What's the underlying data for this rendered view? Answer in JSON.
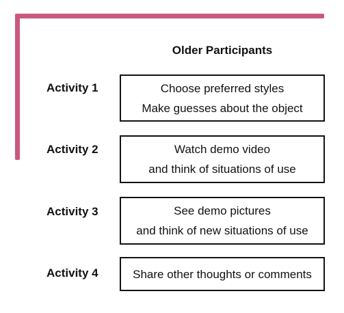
{
  "title": "Older Participants",
  "activities": [
    {
      "label": "Activity 1",
      "lines": [
        "Choose preferred styles",
        "Make guesses about the object"
      ]
    },
    {
      "label": "Activity 2",
      "lines": [
        "Watch demo video",
        "and think of situations of use"
      ]
    },
    {
      "label": "Activity 3",
      "lines": [
        "See demo pictures",
        "and think of new situations of use"
      ]
    },
    {
      "label": "Activity 4",
      "lines": [
        "Share other thoughts or comments"
      ]
    }
  ],
  "colors": {
    "frame": "#c9587f",
    "text": "#111111",
    "box_border": "#111111"
  }
}
